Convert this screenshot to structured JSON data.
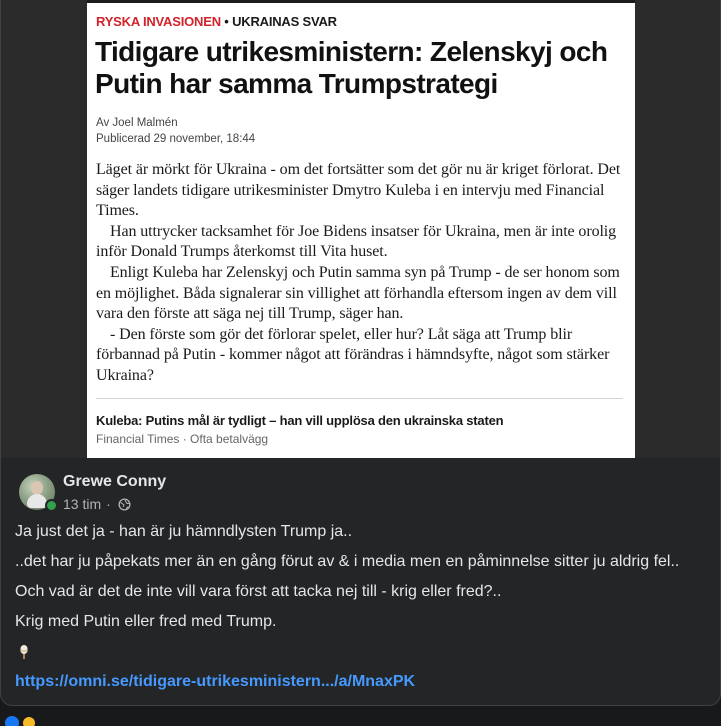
{
  "article": {
    "kicker_section": "RYSKA INVASIONEN",
    "kicker_separator": " • ",
    "kicker_topic": "UKRAINAS SVAR",
    "title": "Tidigare utrikesministern: Zelenskyj och Putin har samma Trumpstrategi",
    "byline_author": "Av Joel Malmén",
    "byline_published": "Publicerad 29 november, 18:44",
    "paragraphs": [
      "Läget är mörkt för Ukraina - om det fortsätter som det gör nu är kriget förlorat. Det säger landets tidigare utrikesminister Dmytro Kuleba i en intervju med Financial Times.",
      "Han uttrycker tacksamhet för Joe Bidens insatser för Ukraina, men är inte orolig inför Donald Trumps återkomst till Vita huset.",
      "Enligt Kuleba har Zelenskyj och Putin samma syn på Trump - de ser honom som en möjlighet. Båda signalerar sin villighet att förhandla eftersom ingen av dem vill vara den förste att säga nej till Trump, säger han.",
      "- Den förste som gör det förlorar spelet, eller hur? Låt säga att Trump blir förbannad på Putin - kommer något att förändras i hämndsyfte, något som stärker Ukraina?"
    ],
    "related_title": "Kuleba: Putins mål är tydligt – han vill upplösa den ukrainska staten",
    "related_source": "Financial Times",
    "related_separator": " · ",
    "related_paywall": "Ofta betalvägg"
  },
  "post": {
    "author": "Grewe Conny",
    "time": "13 tim",
    "separator": "·",
    "privacy_icon": "globe-icon",
    "lines": [
      "Ja just det ja - han är ju hämndlysten Trump ja..",
      "..det har ju påpekats mer än en gång förut av & i media men en påminnelse sitter ju aldrig fel..",
      "Och vad är det de inte vill vara först att tacka nej till - krig eller fred?..",
      "Krig med Putin eller fred med Trump."
    ],
    "emoji_icon": "ice-cream-icon",
    "link": "https://omni.se/tidigare-utrikesministern.../a/MnaxPK"
  },
  "reactions": [
    "like-icon",
    "haha-icon"
  ],
  "colors": {
    "background": "#18191a",
    "card": "#242526",
    "text_primary": "#e4e6eb",
    "text_secondary": "#b0b3b8",
    "link": "#4599ff",
    "online": "#31a24c",
    "kicker_red": "#d2232a"
  }
}
